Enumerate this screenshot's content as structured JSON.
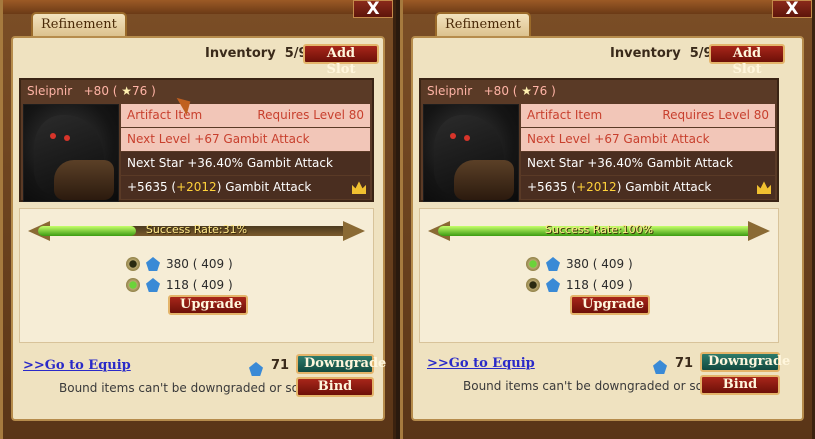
{
  "tab_label": "Refinement",
  "close_label": "X",
  "inventory": {
    "label": "Inventory",
    "value": "5/9"
  },
  "add_slot_label": "Add Slot",
  "item": {
    "name": "Sleipnir",
    "level_plus": "+80",
    "stars": "76",
    "type": "Artifact Item",
    "requirement": "Requires Level 80",
    "next_level": "Next Level +67 Gambit Attack",
    "next_star": "Next Star +36.40% Gambit Attack",
    "attack_base": "+5635",
    "attack_bonus": "+2012",
    "attack_label": "Gambit Attack"
  },
  "materials": [
    {
      "owned": "380",
      "need": "409"
    },
    {
      "owned": "118",
      "need": "409"
    }
  ],
  "upgrade_label": "Upgrade",
  "goto_equip_label": ">>Go to Equip",
  "gem_count": "71",
  "downgrade_label": "Downgrade",
  "bind_label": "Bind",
  "note": "Bound items can't be downgraded or sold.",
  "panels": [
    {
      "success_rate": 0.31,
      "success_label": "Success Rate:31%",
      "selected_material": 1
    },
    {
      "success_rate": 1.0,
      "success_label": "Success Rate:100%",
      "selected_material": 0
    }
  ],
  "colors": {
    "accent_red": "#a8261a",
    "accent_teal": "#2d7a6a",
    "bar_green": "#7ad83a",
    "gold": "#ffd23a"
  }
}
